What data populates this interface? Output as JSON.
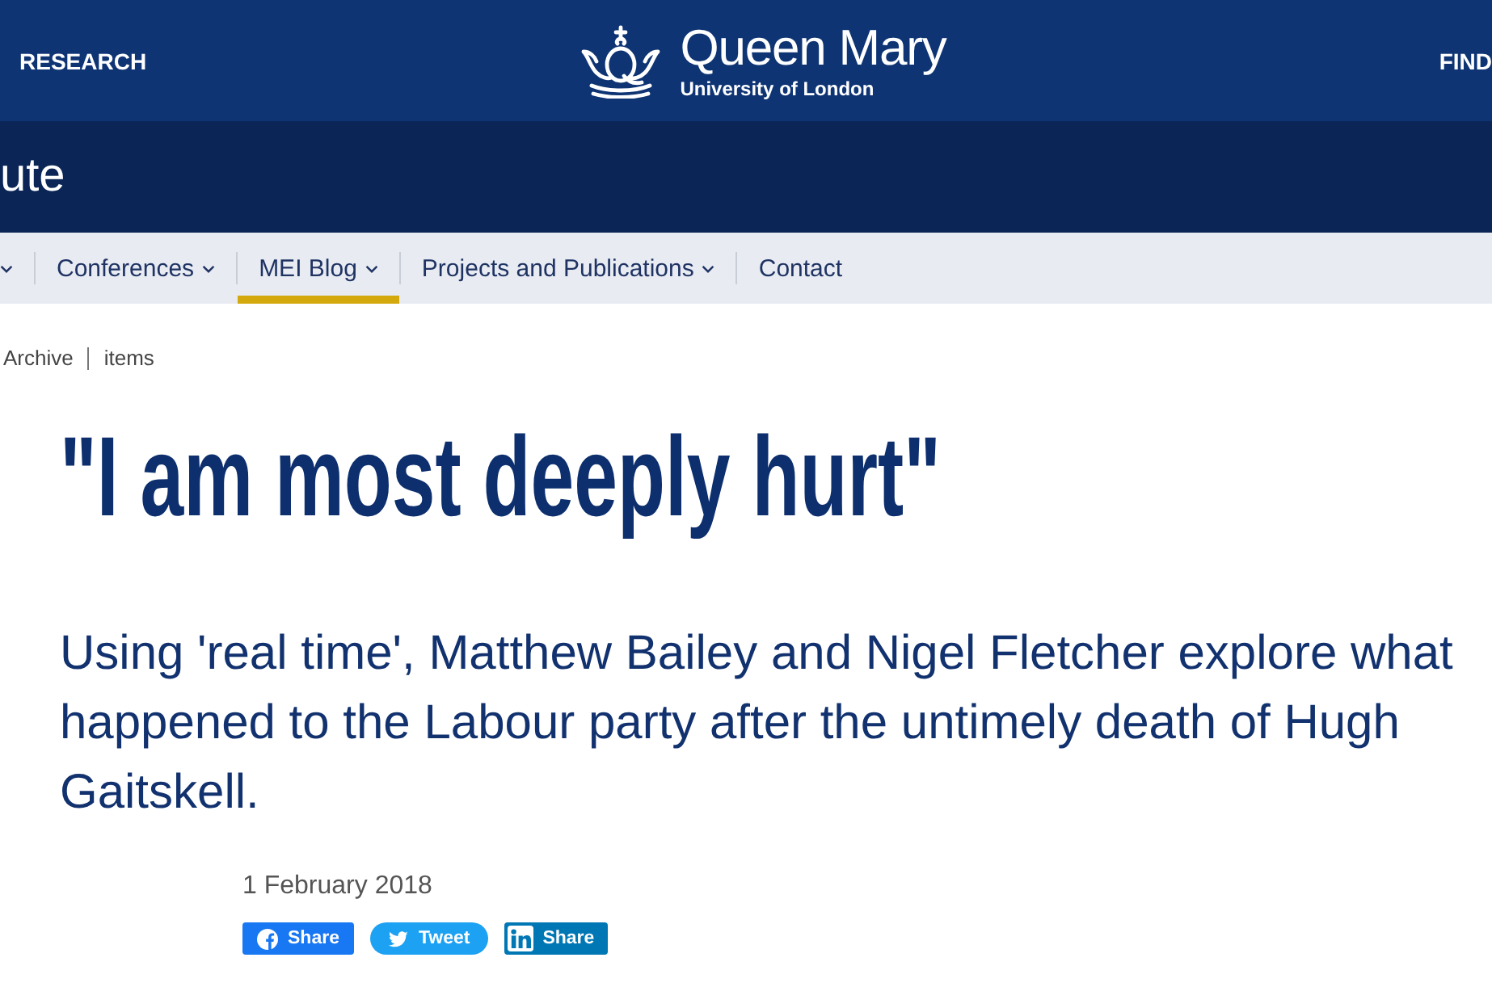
{
  "header": {
    "left_link": "RESEARCH",
    "logo": {
      "name": "Queen Mary",
      "subtitle": "University of London"
    },
    "right_link": "FIND"
  },
  "site_banner": {
    "title": "ute"
  },
  "nav": {
    "items": [
      {
        "dropdown": true,
        "selected": false
      },
      {
        "label": "Conferences",
        "dropdown": true,
        "selected": false
      },
      {
        "label": "MEI Blog",
        "dropdown": true,
        "selected": true
      },
      {
        "label": "Projects and Publications",
        "dropdown": true,
        "selected": false
      },
      {
        "label": "Contact",
        "dropdown": false,
        "selected": false
      }
    ]
  },
  "breadcrumb": [
    "Archive",
    "items"
  ],
  "article": {
    "title": "\"I am most deeply hurt\"",
    "standfirst": "Using 'real time', Matthew Bailey and Nigel Fletcher explore what happened to the Labour party after the untimely death of Hugh Gaitskell.",
    "date": "1 February 2018",
    "share_buttons": [
      {
        "kind": "facebook",
        "label": "Share"
      },
      {
        "kind": "twitter",
        "label": "Tweet"
      },
      {
        "kind": "linkedin",
        "label": "Share"
      }
    ]
  }
}
